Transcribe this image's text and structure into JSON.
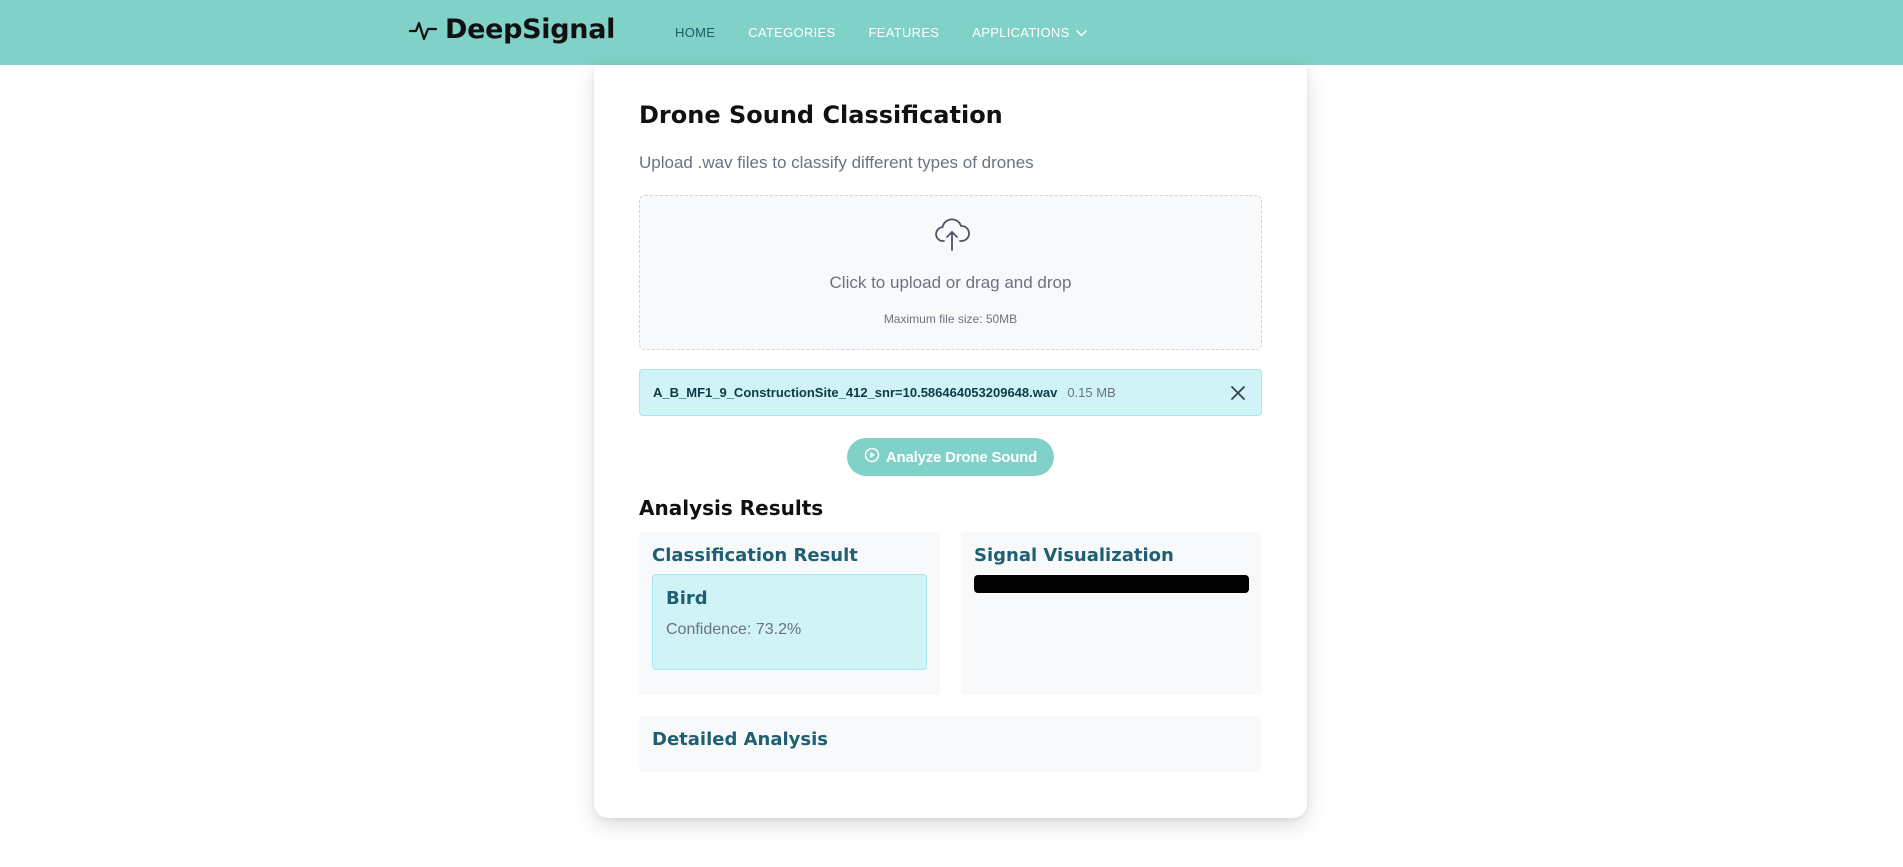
{
  "header": {
    "brand": "DeepSignal",
    "nav": [
      {
        "label": "HOME"
      },
      {
        "label": "CATEGORIES"
      },
      {
        "label": "FEATURES"
      },
      {
        "label": "APPLICATIONS"
      }
    ]
  },
  "main": {
    "title": "Drone Sound Classification",
    "subtitle": "Upload .wav files to classify different types of drones",
    "upload": {
      "text": "Click to upload or drag and drop",
      "hint": "Maximum file size: 50MB"
    },
    "file": {
      "name": "A_B_MF1_9_ConstructionSite_412_snr=10.586464053209648.wav",
      "size": "0.15 MB"
    },
    "analyze_label": "Analyze Drone Sound",
    "results_heading": "Analysis Results",
    "classification": {
      "title": "Classification Result",
      "label": "Bird",
      "confidence": "Confidence: 73.2%"
    },
    "signal": {
      "title": "Signal Visualization"
    },
    "detail": {
      "title": "Detailed Analysis"
    }
  },
  "colors": {
    "header_bg": "#80d1c8",
    "accent_dark": "#1f5f72",
    "result_bg": "#cff3f7"
  }
}
